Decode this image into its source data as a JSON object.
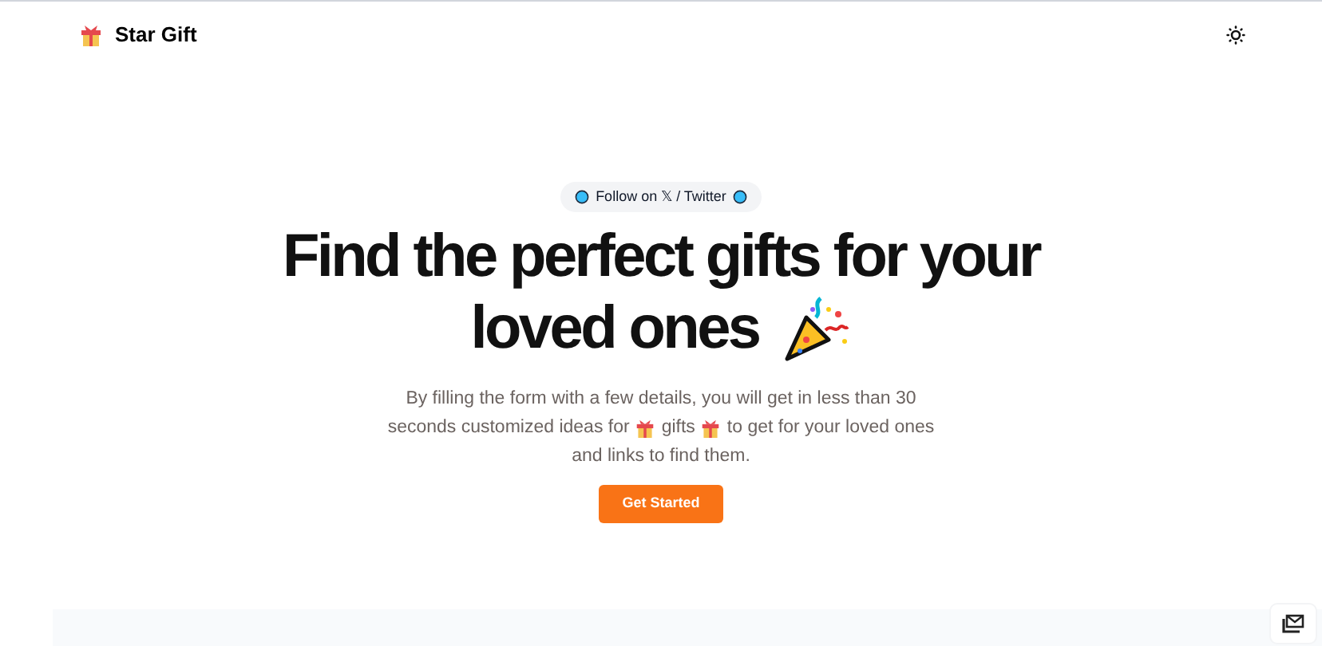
{
  "header": {
    "brand": "Star Gift"
  },
  "badge": {
    "label": "Follow on 𝕏 / Twitter"
  },
  "headline": [
    "Find the perfect gifts for your",
    "loved ones"
  ],
  "description": [
    [
      "By filling the form with a few details, you will get in less than 30"
    ],
    [
      "seconds customized ideas for",
      "gifts",
      "to get for your loved ones"
    ],
    [
      "and links to find them."
    ]
  ],
  "cta": {
    "label": "Get Started"
  }
}
